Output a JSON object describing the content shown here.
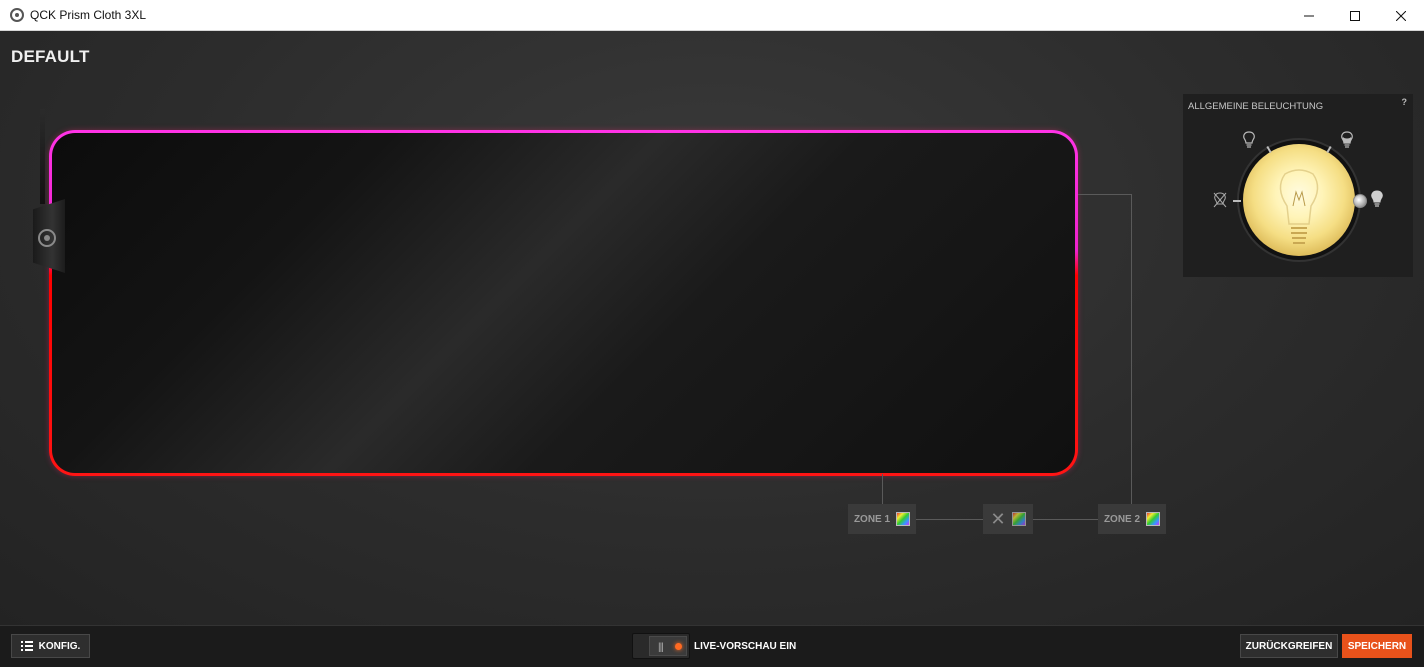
{
  "window": {
    "title": "QCK Prism Cloth 3XL",
    "minimize": "minimize-icon",
    "maximize": "maximize-icon",
    "close": "close-icon"
  },
  "profile": {
    "name": "DEFAULT"
  },
  "device": {
    "glow_top_color": "#ff33e6",
    "glow_bottom_color": "#ff1414"
  },
  "zones": [
    {
      "label": "ZONE 1",
      "icon": "color-swatch-icon"
    },
    {
      "label": "",
      "icon": "x-icon"
    },
    {
      "label": "ZONE 2",
      "icon": "color-swatch-icon"
    }
  ],
  "lighting": {
    "title": "ALLGEMEINE BELEUCHTUNG",
    "help": "?",
    "levels": [
      "off-icon",
      "low-bulb-icon",
      "medium-bulb-icon",
      "high-bulb-icon"
    ],
    "selected_level": "high-bulb-icon"
  },
  "bottom": {
    "config_label": "KONFIG.",
    "live_preview_label": "LIVE-VORSCHAU EIN",
    "live_preview_on": true,
    "revert_label": "ZURÜCKGREIFEN",
    "save_label": "SPEICHERN",
    "accent": "#e8521b"
  }
}
